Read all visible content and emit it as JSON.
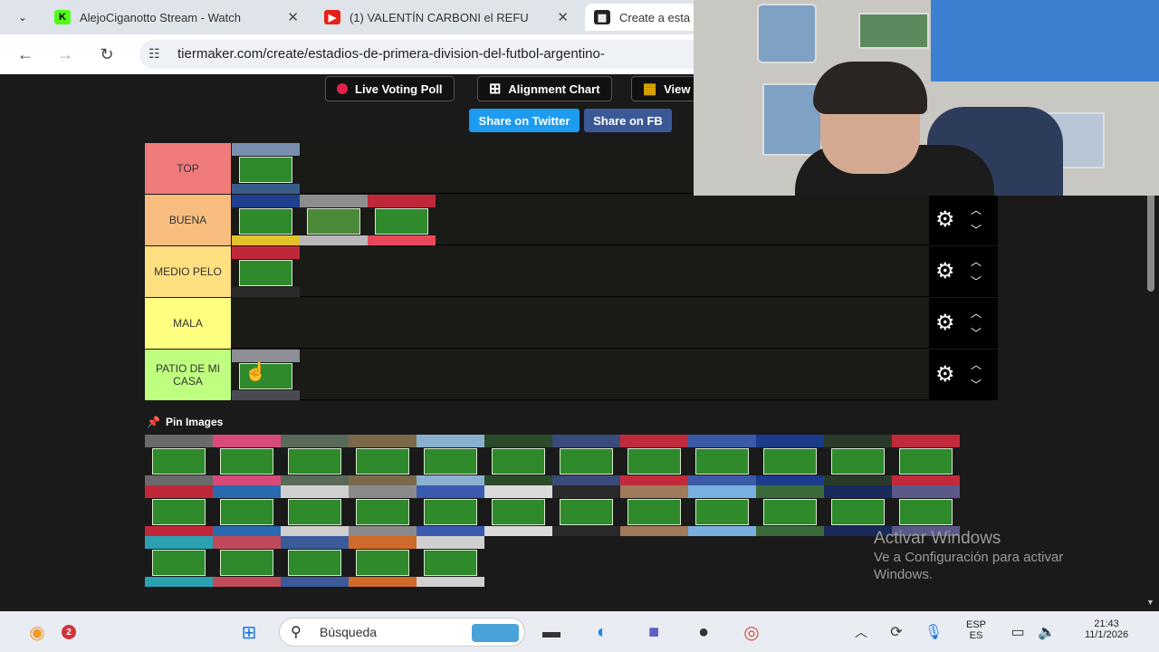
{
  "browser": {
    "tabs": [
      {
        "title": "AlejoCiganotto Stream - Watch",
        "favicon": "kick-icon",
        "color": "#1a1a1a"
      },
      {
        "title": "(1) VALENTÍN CARBONI el REFU",
        "favicon": "youtube-icon",
        "color": "#e62117"
      },
      {
        "title": "Create a esta",
        "favicon": "tiermaker-icon",
        "color": "#222"
      }
    ],
    "url": "tiermaker.com/create/estadios-de-primera-division-del-futbol-argentino-"
  },
  "toolbar": {
    "live_voting": "Live Voting Poll",
    "alignment_chart": "Alignment Chart",
    "view": "View",
    "share_twitter": "Share on Twitter",
    "share_fb": "Share on FB"
  },
  "tiers": [
    {
      "label": "TOP",
      "color": "#f07b7b",
      "images": 1
    },
    {
      "label": "BUENA",
      "color": "#f8bd7f",
      "images": 3
    },
    {
      "label": "MEDIO PELO",
      "color": "#ffdf80",
      "images": 1
    },
    {
      "label": "MALA",
      "color": "#ffff80",
      "images": 0
    },
    {
      "label": "PATIO DE MI CASA",
      "color": "#bfff7f",
      "images": 1
    }
  ],
  "pin_images": {
    "title": "Pin Images",
    "count": 29
  },
  "watermark": {
    "title": "Activar Windows",
    "line1": "Ve a Configuración para activar",
    "line2": "Windows."
  },
  "taskbar": {
    "search_placeholder": "Búsqueda",
    "notification_count": "2",
    "language": "ESP",
    "region": "ES",
    "time": "21:43",
    "date": "11/1/2026"
  }
}
